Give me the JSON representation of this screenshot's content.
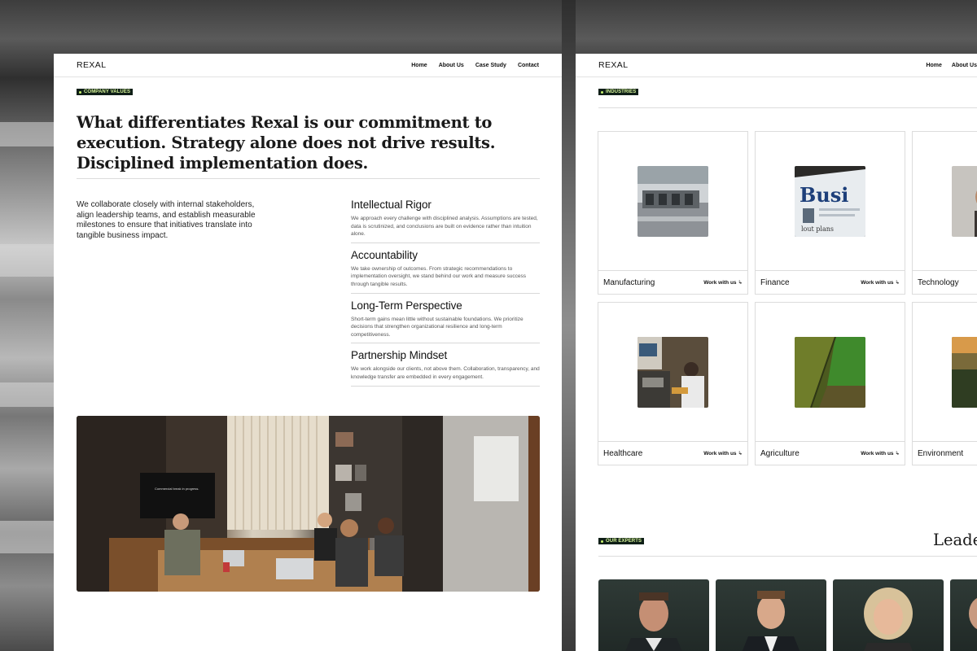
{
  "left_page": {
    "brand": "REXAL",
    "nav": [
      "Home",
      "About Us",
      "Case Study",
      "Contact"
    ],
    "tag": "COMPANY VALUES",
    "headline": "What differentiates Rexal is our commitment to execution. Strategy alone does not drive results. Disciplined implementation does.",
    "intro": "We collaborate closely with internal stakeholders, align leadership teams, and establish measurable milestones to ensure that initiatives translate into tangible business impact.",
    "values": [
      {
        "title": "Intellectual Rigor",
        "text": "We approach every challenge with disciplined analysis. Assumptions are tested, data is scrutinized, and conclusions are built on evidence rather than intuition alone."
      },
      {
        "title": "Accountability",
        "text": "We take ownership of outcomes. From strategic recommendations to implementation oversight, we stand behind our work and measure success through tangible results."
      },
      {
        "title": "Long-Term Perspective",
        "text": "Short-term gains mean little without sustainable foundations. We prioritize decisions that strengthen organizational resilience and long-term competitiveness."
      },
      {
        "title": "Partnership Mindset",
        "text": "We work alongside our clients, not above them. Collaboration, transparency, and knowledge transfer are embedded in every engagement."
      }
    ],
    "photo_screen_text": "Commercial break in progress."
  },
  "right_page": {
    "brand": "REXAL",
    "nav": [
      "Home",
      "About Us"
    ],
    "industries_tag": "INDUSTRIES",
    "cta": "Work with us",
    "industries": [
      "Manufacturing",
      "Finance",
      "Technology",
      "Healthcare",
      "Agriculture",
      "Environment"
    ],
    "thumb_text": {
      "finance_word": "Busi",
      "finance_sub": "lout plans"
    },
    "experts_tag": "OUR EXPERTS",
    "experts_heading": "Leade"
  },
  "colors": {
    "tag_bg": "#0f1f17",
    "tag_text": "#d7f59a",
    "tag_dot": "#c6f26d",
    "text": "#111111",
    "rule": "#dcdcdc"
  },
  "icons": {
    "cta_arrow": "down-right-arrow-icon",
    "tag_dot": "bullet-dot-icon"
  }
}
